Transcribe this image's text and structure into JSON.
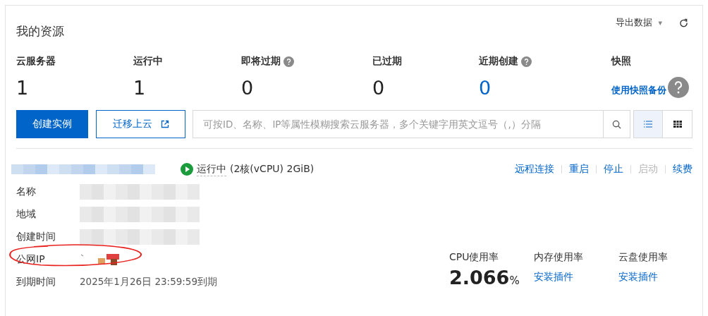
{
  "header": {
    "title": "我的资源",
    "export_label": "导出数据",
    "export_caret": "▾"
  },
  "stats": [
    {
      "label": "云服务器",
      "value": "1",
      "help": false,
      "kind": "number"
    },
    {
      "label": "运行中",
      "value": "1",
      "help": false,
      "kind": "number"
    },
    {
      "label": "即将过期",
      "value": "0",
      "help": true,
      "kind": "number"
    },
    {
      "label": "已过期",
      "value": "0",
      "help": false,
      "kind": "number"
    },
    {
      "label": "近期创建",
      "value": "0",
      "help": true,
      "kind": "link-number"
    },
    {
      "label": "快照",
      "value": "使用快照备份",
      "help": false,
      "kind": "link"
    }
  ],
  "toolbar": {
    "primary_button": "创建实例",
    "secondary_button": "迁移上云",
    "search": {
      "placeholder": "可按ID、名称、IP等属性模糊搜索云服务器，多个关键字用英文逗号（,）分隔"
    },
    "views": [
      {
        "kind": "list",
        "selected": true
      },
      {
        "kind": "grid",
        "selected": false
      }
    ]
  },
  "instance": {
    "status": "运行中",
    "spec": "(2核(vCPU) 2GiB)",
    "actions": [
      {
        "label": "远程连接",
        "disabled": false
      },
      {
        "label": "重启",
        "disabled": false
      },
      {
        "label": "停止",
        "disabled": false
      },
      {
        "label": "启动",
        "disabled": true
      },
      {
        "label": "续费",
        "disabled": false
      }
    ],
    "details": [
      {
        "label": "名称",
        "kind": "blurred"
      },
      {
        "label": "地域",
        "kind": "blurred"
      },
      {
        "label": "创建时间",
        "kind": "blurred"
      },
      {
        "label": "公网IP",
        "kind": "redacted"
      },
      {
        "label": "到期时间",
        "kind": "text",
        "value": "2025年1月26日 23:59:59到期"
      }
    ],
    "metrics": [
      {
        "label": "CPU使用率",
        "kind": "value",
        "value": "2.066",
        "unit": "%"
      },
      {
        "label": "内存使用率",
        "kind": "link",
        "value": "安装插件"
      },
      {
        "label": "云盘使用率",
        "kind": "link",
        "value": "安装插件"
      }
    ]
  }
}
